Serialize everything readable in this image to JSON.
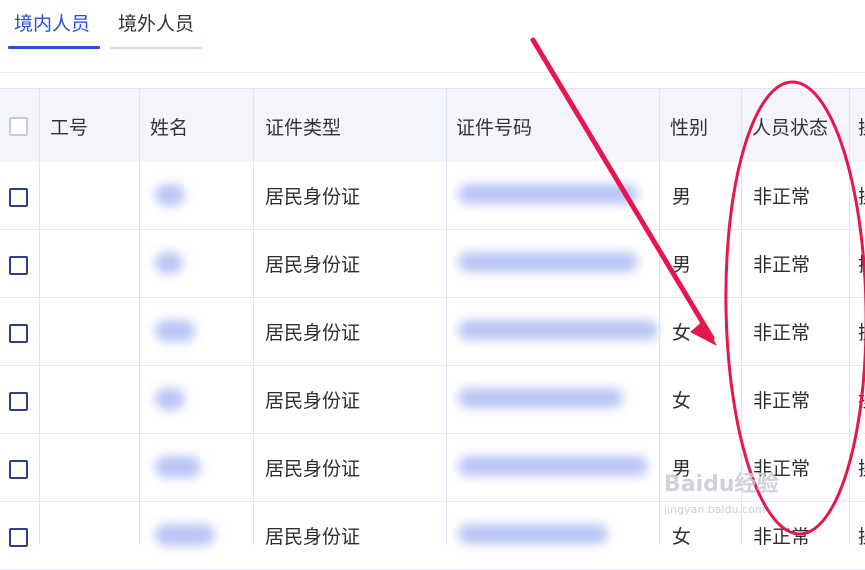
{
  "tabs": [
    {
      "label": "境内人员",
      "active": true
    },
    {
      "label": "境外人员",
      "active": false
    }
  ],
  "table": {
    "headers": [
      "工号",
      "姓名",
      "证件类型",
      "证件号码",
      "性别",
      "人员状态",
      "操"
    ],
    "rows": [
      {
        "id_type": "居民身份证",
        "gender": "男",
        "status": "非正常",
        "extra": "操"
      },
      {
        "id_type": "居民身份证",
        "gender": "男",
        "status": "非正常",
        "extra": "操"
      },
      {
        "id_type": "居民身份证",
        "gender": "女",
        "status": "非正常",
        "extra": "操"
      },
      {
        "id_type": "居民身份证",
        "gender": "女",
        "status": "非正常",
        "extra": "操"
      },
      {
        "id_type": "居民身份证",
        "gender": "男",
        "status": "非正常",
        "extra": "操"
      },
      {
        "id_type": "居民身份证",
        "gender": "女",
        "status": "非正常",
        "extra": "操"
      }
    ]
  },
  "annotation_color": "#e6174f",
  "accent_color": "#2a4fe0",
  "watermark": {
    "brand": "Baidu经验",
    "url": "jingyan.baidu.com"
  }
}
